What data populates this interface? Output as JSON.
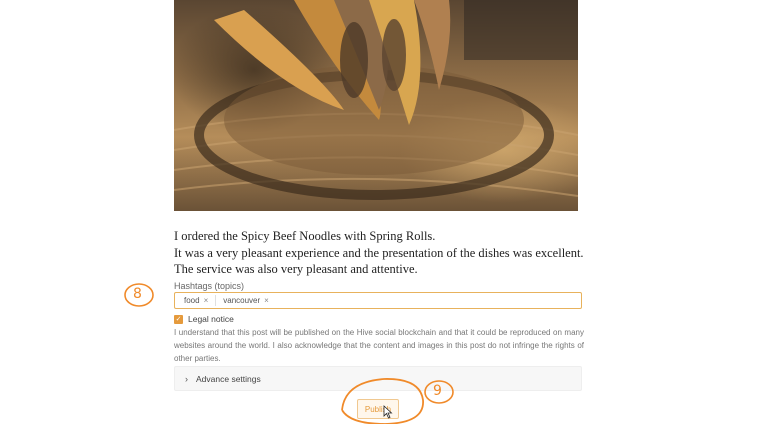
{
  "post": {
    "lines": [
      "I ordered the Spicy Beef Noodles with Spring Rolls.",
      "It was a very pleasant experience and the presentation of the dishes was excellent.",
      "The service was also very pleasant and attentive."
    ]
  },
  "hashtags": {
    "label": "Hashtags (topics)",
    "tags": [
      "food",
      "vancouver"
    ],
    "remove_glyph": "×"
  },
  "legal": {
    "checked": true,
    "label": "Legal notice",
    "text": "I understand that this post will be published on the Hive social blockchain and that it could be reproduced on many websites around the world. I also acknowledge that the content and images in this post do not infringe the rights of other parties."
  },
  "advance": {
    "label": "Advance settings",
    "icon": "chevron-right-icon"
  },
  "publish": {
    "label": "Publish"
  },
  "annotations": {
    "step_a": "8",
    "step_b": "9"
  },
  "colors": {
    "accent": "#e59a3c",
    "annotation": "#f08a2a"
  }
}
